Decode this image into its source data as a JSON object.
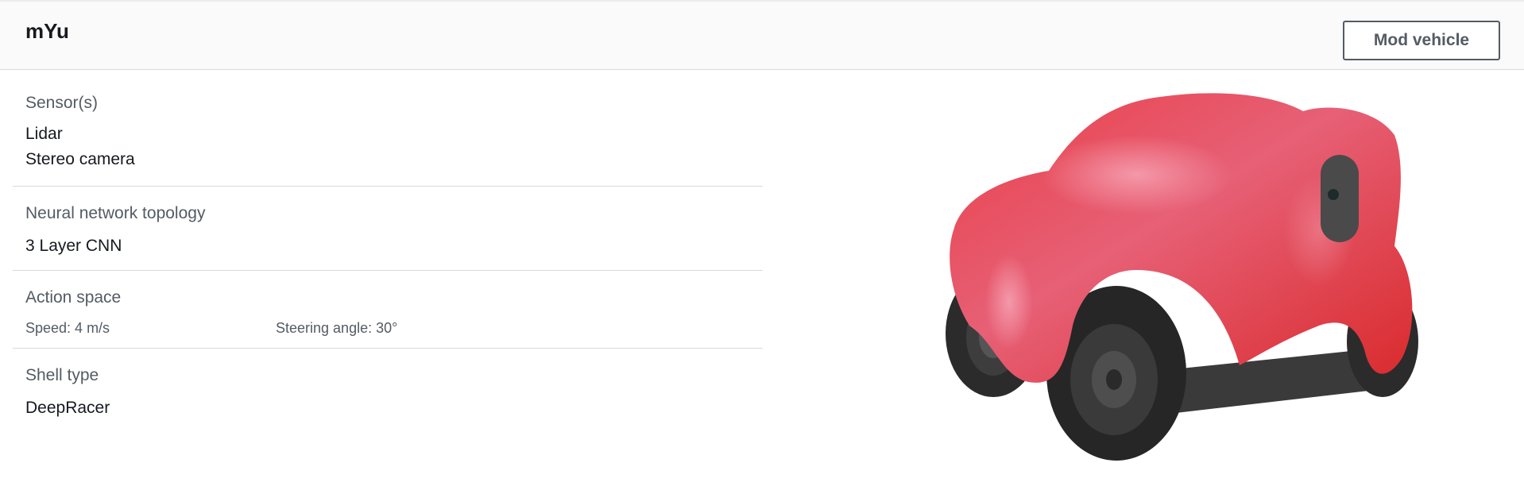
{
  "header": {
    "title": "mYu",
    "mod_button_label": "Mod vehicle"
  },
  "details": {
    "sensors": {
      "label": "Sensor(s)",
      "items": [
        "Lidar",
        "Stereo camera"
      ]
    },
    "neural_network": {
      "label": "Neural network topology",
      "value": "3 Layer CNN"
    },
    "action_space": {
      "label": "Action space",
      "speed": "Speed: 4 m/s",
      "steering": "Steering angle: 30°"
    },
    "shell_type": {
      "label": "Shell type",
      "value": "DeepRacer"
    }
  },
  "vehicle_image": {
    "icon": "deepracer-car-image",
    "shell_color": "#e0303a",
    "tire_color": "#2a2a2a"
  }
}
